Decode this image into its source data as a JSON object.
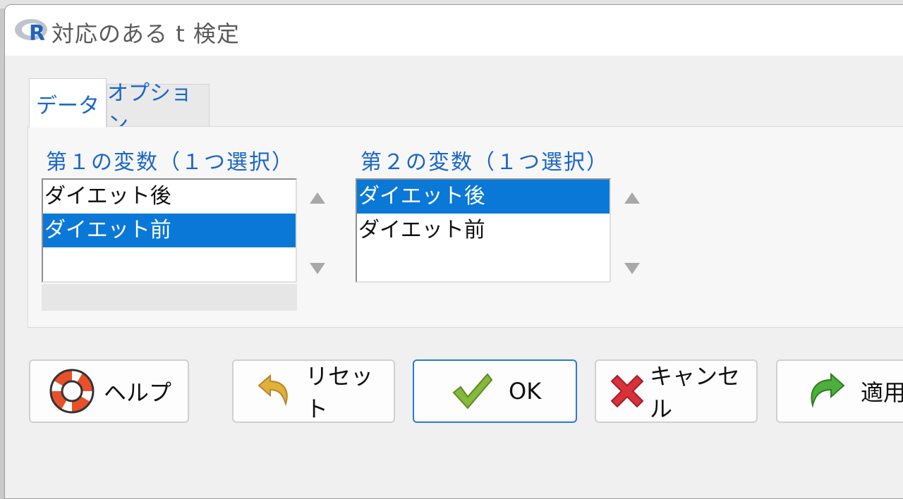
{
  "window": {
    "title": "対応のある t 検定"
  },
  "tabs": [
    {
      "label": "データ",
      "active": true
    },
    {
      "label": "オプション",
      "active": false
    }
  ],
  "variable1": {
    "label": "第１の変数（１つ選択）",
    "items": [
      "ダイエット後",
      "ダイエット前"
    ],
    "selected_index": 1
  },
  "variable2": {
    "label": "第２の変数（１つ選択）",
    "items": [
      "ダイエット後",
      "ダイエット前"
    ],
    "selected_index": 0
  },
  "buttons": {
    "help": "ヘルプ",
    "reset": "リセット",
    "ok": "OK",
    "cancel": "キャンセル",
    "apply": "適用"
  },
  "colors": {
    "accent_blue": "#1a66c9",
    "selection": "#0a78d7",
    "ok_border": "#2a7ad5"
  }
}
